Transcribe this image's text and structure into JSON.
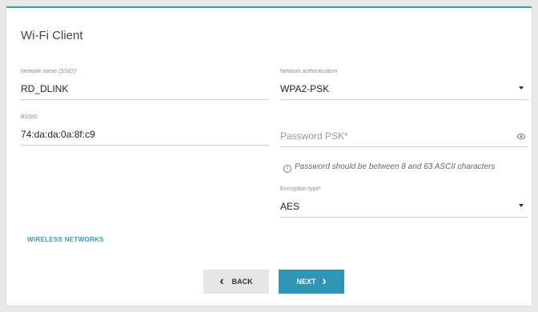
{
  "page": {
    "title": "Wi-Fi Client"
  },
  "form": {
    "ssid": {
      "label": "Network name (SSID)*",
      "value": "RD_DLINK"
    },
    "bssid": {
      "label": "BSSID",
      "value": "74:da:da:0a:8f:c9"
    },
    "auth": {
      "label": "Network authentication",
      "value": "WPA2-PSK"
    },
    "password": {
      "placeholder": "Password PSK*"
    },
    "hint": {
      "icon": "info-icon",
      "text": "Password should be between 8 and 63 ASCII characters"
    },
    "encryption": {
      "label": "Encryption type*",
      "value": "AES"
    }
  },
  "links": {
    "wireless_networks": "WIRELESS NETWORKS"
  },
  "buttons": {
    "back": "BACK",
    "next": "NEXT"
  },
  "colors": {
    "accent": "#2f97b5"
  }
}
